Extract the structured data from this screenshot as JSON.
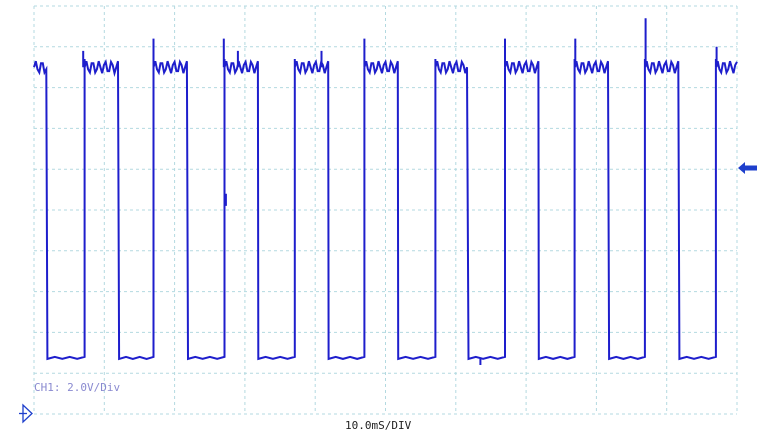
{
  "chart_data": {
    "type": "line",
    "title": "",
    "xlabel": "10.0mS/DIV",
    "ylabel": "CH1: 2.0V/Div",
    "x_unit": "ms",
    "x_per_div": 10,
    "y_per_div": 2.0,
    "x_divisions": 10,
    "y_divisions": 10,
    "xlim": [
      0,
      100
    ],
    "ylim": [
      -8.8,
      11.2
    ],
    "grid": true,
    "channel": "CH1",
    "trace_color": "#1e1ecc",
    "grid_color": "#b3d9e0",
    "marker_color": "#1e3fcc",
    "series": [
      {
        "name": "",
        "high_v": 8.2,
        "low_v": -6.1,
        "edges_ms": [
          [
            1.9,
            7.2
          ],
          [
            12.1,
            17.0
          ],
          [
            21.9,
            27.1
          ],
          [
            31.9,
            37.1
          ],
          [
            41.9,
            47.0
          ],
          [
            51.8,
            57.1
          ],
          [
            61.8,
            67.0
          ],
          [
            71.8,
            76.9
          ],
          [
            81.8,
            86.9
          ],
          [
            91.8,
            97.0
          ]
        ],
        "spikes_ms_v": [
          [
            7.0,
            9.0
          ],
          [
            17.0,
            9.6
          ],
          [
            27.0,
            9.6
          ],
          [
            29.0,
            9.0
          ],
          [
            40.9,
            9.0
          ],
          [
            47.0,
            9.6
          ],
          [
            67.0,
            9.6
          ],
          [
            77.0,
            9.6
          ],
          [
            87.0,
            10.6
          ],
          [
            97.1,
            9.2
          ]
        ],
        "glitches_ms_v": [
          [
            27.3,
            2.0
          ],
          [
            63.5,
            -6.4
          ]
        ]
      }
    ]
  },
  "labels": {
    "channel": "CH1: 2.0V/Div",
    "timebase": "10.0mS/DIV"
  }
}
